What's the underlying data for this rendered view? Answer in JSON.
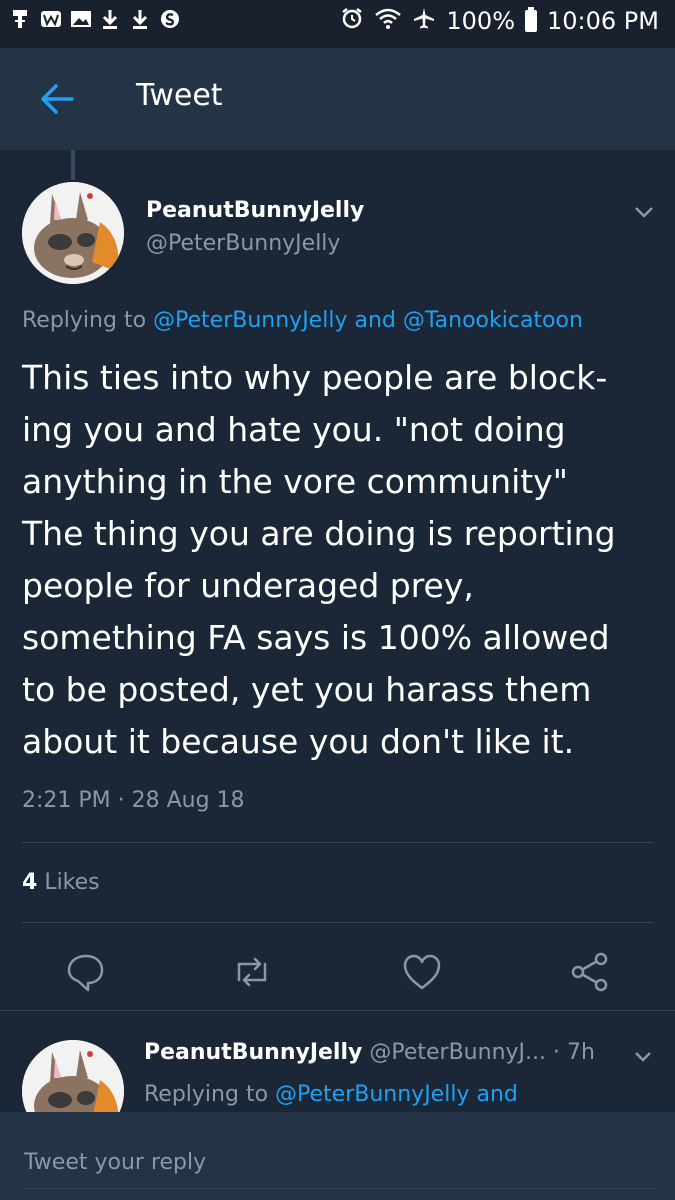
{
  "status_bar": {
    "left_icons": [
      "usb-icon",
      "w-notification-icon",
      "image-icon",
      "download-icon",
      "download-icon",
      "s-notification-icon"
    ],
    "battery": "100%",
    "time": "10:06 PM"
  },
  "header": {
    "title": "Tweet"
  },
  "tweet": {
    "display_name": "PeanutBunnyJelly",
    "handle": "@PeterBunnyJelly",
    "replying_prefix": "Replying to",
    "replying_user1": "@PeterBunnyJelly",
    "replying_and": "and",
    "replying_user2": "@Tanookicatoon",
    "text": "This ties into why people are block-\ning you and hate you. \"not doing\nanything in the vore community\"\nThe thing you are doing is reporting\npeople for underaged prey,\nsomething FA says is 100% allowed\nto be posted, yet you harass them\nabout it because you don't like it.",
    "timestamp": "2:21 PM · 28 Aug 18",
    "likes_count": "4",
    "likes_label": "Likes"
  },
  "reply_preview": {
    "display_name": "PeanutBunnyJelly",
    "handle": "@PeterBunnyJ...",
    "time": "· 7h",
    "replying_prefix": "Replying to",
    "replying_user": "@PeterBunnyJelly and"
  },
  "compose": {
    "placeholder": "Tweet your reply"
  },
  "colors": {
    "background": "#1b2737",
    "header": "#243447",
    "accent": "#1da1f2",
    "secondary_text": "#8899a6"
  }
}
